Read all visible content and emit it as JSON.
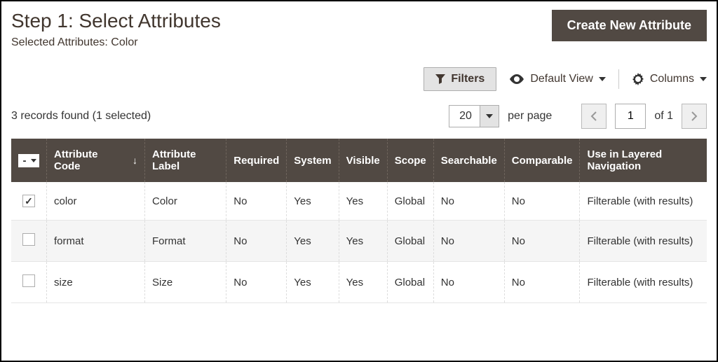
{
  "header": {
    "title": "Step 1: Select Attributes",
    "subtitle": "Selected Attributes: Color",
    "create_btn": "Create New Attribute"
  },
  "toolbar": {
    "filters": "Filters",
    "default_view": "Default View",
    "columns": "Columns"
  },
  "records": {
    "summary": "3 records found (1 selected)",
    "per_page_value": "20",
    "per_page_label": "per page",
    "page_current": "1",
    "of_label": "of 1"
  },
  "columns": {
    "attr_code": "Attribute Code",
    "attr_label": "Attribute Label",
    "required": "Required",
    "system": "System",
    "visible": "Visible",
    "scope": "Scope",
    "searchable": "Searchable",
    "comparable": "Comparable",
    "layered": "Use in Layered Navigation"
  },
  "rows": [
    {
      "checked": true,
      "code": "color",
      "label": "Color",
      "required": "No",
      "system": "Yes",
      "visible": "Yes",
      "scope": "Global",
      "searchable": "No",
      "comparable": "No",
      "layered": "Filterable (with results)"
    },
    {
      "checked": false,
      "code": "format",
      "label": "Format",
      "required": "No",
      "system": "Yes",
      "visible": "Yes",
      "scope": "Global",
      "searchable": "No",
      "comparable": "No",
      "layered": "Filterable (with results)"
    },
    {
      "checked": false,
      "code": "size",
      "label": "Size",
      "required": "No",
      "system": "Yes",
      "visible": "Yes",
      "scope": "Global",
      "searchable": "No",
      "comparable": "No",
      "layered": "Filterable (with results)"
    }
  ]
}
